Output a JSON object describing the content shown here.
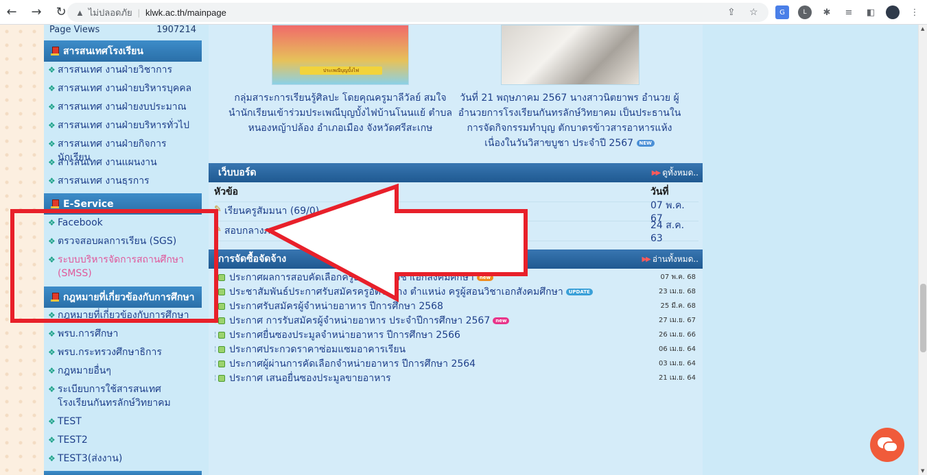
{
  "browser": {
    "insecure_label": "ไม่ปลอดภัย",
    "url": "klwk.ac.th/mainpage"
  },
  "sidebar": {
    "page_views_label": "Page Views",
    "page_views_value": "1907214",
    "info_section": {
      "title": "สารสนเทศโรงเรียน",
      "items": [
        "สารสนเทศ งานฝ่ายวิชาการ",
        "สารสนเทศ งานฝ่ายบริหารบุคคล",
        "สารสนเทศ งานฝ่ายงบประมาณ",
        "สารสนเทศ งานฝ่ายบริหารทั่วไป",
        "สารสนเทศ งานฝ่ายกิจการนักเรียน",
        "สารสนเทศ งานแผนงาน",
        "สารสนเทศ งานธุรการ"
      ]
    },
    "eservice_section": {
      "title": "E-Service",
      "items": [
        "Facebook",
        "ตรวจสอบผลการเรียน (SGS)",
        "ระบบบริหารจัดการสถานศึกษา (SMSS)"
      ]
    },
    "law_section": {
      "title": "กฎหมายที่เกี่ยวข้องกับการศึกษา",
      "items": [
        "กฎหมายที่เกี่ยวข้องกับการศึกษา",
        "พรบ.การศึกษา",
        "พรบ.กระทรวงศึกษาธิการ",
        "กฎหมายอื่นๆ",
        "ระเบียบการใช้สารสนเทศ โรงเรียนกันทรลักษ์วิทยาคม",
        "TEST",
        "TEST2",
        "TEST3(ส่งงาน)"
      ]
    }
  },
  "news": {
    "item1": "กลุ่มสาระการเรียนรู้ศิลปะ โดยคุณครูมาลีวัลย์ สมใจ นำนักเรียนเข้าร่วมประเพณีบุญบั้งไฟบ้านโนนแย้ ตำบลหนองหญ้าปล้อง อำเภอเมือง จังหวัดศรีสะเกษ",
    "item1_banner": "ประเพณีบุญบั้งไฟ",
    "item2": "วันที่ 21 พฤษภาคม 2567 นางสาวนิตยาพร อำนวย ผู้อำนวยการโรงเรียนกันทรลักษ์วิทยาคม เป็นประธานในการจัดกิจกรรมทำบุญ ตักบาตรข้าวสารอาหารแห้ง เนื่องในวันวิสาขบูชา ประจำปี 2567",
    "new_badge": "NEW"
  },
  "webboard": {
    "title": "เว็บบอร์ด",
    "more": "ดูทั้งหมด..",
    "col_topic": "หัวข้อ",
    "col_date": "วันที่",
    "rows": [
      {
        "topic": "เรียนครูสัมมนา (69/0)",
        "date": "07 พ.ค. 67"
      },
      {
        "topic": "สอบกลางภาค (2/0)",
        "date": "24 ส.ค. 63"
      }
    ]
  },
  "procurement": {
    "title": "การจัดซื้อจัดจ้าง",
    "more": "อ่านทั้งหมด..",
    "rows": [
      {
        "text": "ประกาศผลการสอบคัดเลือกครูอัตราจ้าง วิชาเอกสังคมศึกษา",
        "badge": "new",
        "badge_style": "orange",
        "date": "07 พ.ค. 68"
      },
      {
        "text": "ประชาสัมพันธ์ประกาศรับสมัครครูอัตราจ้าง ตำแหน่ง ครูผู้สอนวิชาเอกสังคมศึกษา",
        "badge": "UPDATE",
        "badge_style": "upd",
        "date": "23 เม.ย. 68"
      },
      {
        "text": "ประกาศรับสมัครผู้จำหน่ายอาหาร ปีการศึกษา 2568",
        "badge": "",
        "badge_style": "",
        "date": "25 มี.ค. 68"
      },
      {
        "text": "ประกาศ การรับสมัครผู้จำหน่ายอาหาร ประจำปีการศึกษา 2567",
        "badge": "new",
        "badge_style": "pink",
        "date": "27 เม.ย. 67"
      },
      {
        "text": "ประกาศยื่นซองประมูลจำหน่ายอาหาร ปีการศึกษา 2566",
        "badge": "",
        "badge_style": "",
        "date": "26 เม.ย. 66"
      },
      {
        "text": "ประกาศประกวดราคาซ่อมแซมอาคารเรียน",
        "badge": "",
        "badge_style": "",
        "date": "06 เม.ย. 64"
      },
      {
        "text": "ประกาศผู้ผ่านการคัดเลือกจำหน่ายอาหาร ปีการศึกษา 2564",
        "badge": "",
        "badge_style": "",
        "date": "03 เม.ย. 64"
      },
      {
        "text": "ประกาศ เสนอยื่นซองประมูลขายอาหาร",
        "badge": "",
        "badge_style": "",
        "date": "21 เม.ย. 64"
      }
    ]
  },
  "icons": {
    "back": "back-arrow-icon",
    "forward": "forward-arrow-icon",
    "reload": "reload-icon",
    "warning": "warning-icon",
    "share": "share-icon",
    "star": "star-icon",
    "chat": "chat-bubble-icon"
  },
  "colors": {
    "annotation_red": "#e8202a",
    "header_blue": "#2a6fa8",
    "content_bg": "#cdeaf8",
    "link": "#1e3f8a",
    "smss_pink": "#e0599b"
  }
}
